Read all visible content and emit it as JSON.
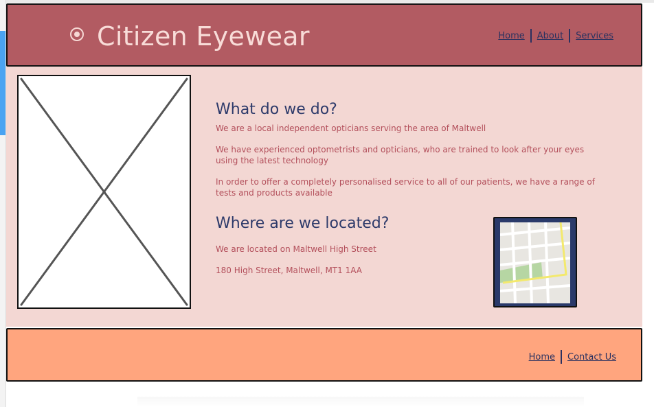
{
  "header": {
    "title": "Citizen Eyewear",
    "logo_icon": "target-icon",
    "nav": [
      "Home",
      "About",
      "Services"
    ]
  },
  "main": {
    "image_placeholder_icon": "image-placeholder-icon",
    "what_heading": "What do we do?",
    "what_paragraphs": [
      "We are a local independent opticians serving the area of Maltwell",
      "We have experienced optometrists and opticians, who are trained to look after your eyes using the latest technology",
      "In order to offer a completely personalised service to all of our patients, we have a range of tests and products available"
    ],
    "where_heading": "Where are we located?",
    "where_paragraphs": [
      "We are located on Maltwell High Street",
      "180 High Street, Maltwell, MT1 1AA"
    ],
    "map_icon": "map-icon"
  },
  "footer": {
    "nav": [
      "Home",
      "Contact Us"
    ]
  },
  "colors": {
    "header_bg": "#b25b62",
    "main_bg": "#f3d7d3",
    "footer_bg": "#ffa57e",
    "heading": "#2d3a6a",
    "body_text": "#b34f5b",
    "link": "#2a3160"
  }
}
